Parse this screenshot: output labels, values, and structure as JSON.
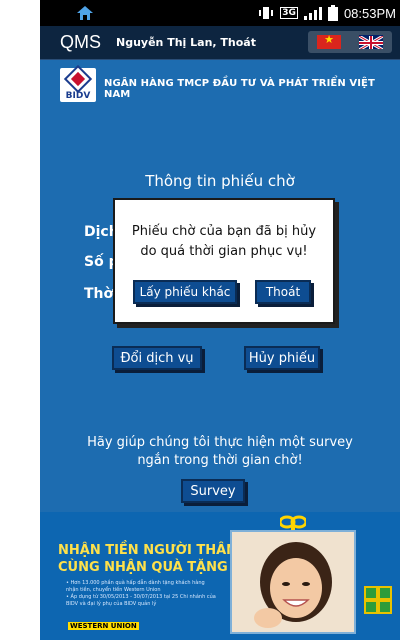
{
  "status": {
    "time": "08:53PM",
    "network": "3G"
  },
  "header": {
    "app_title": "QMS",
    "user_name": "Nguyễn Thị Lan, Thoát"
  },
  "bank": {
    "logo_text": "BIDV",
    "name": "NGÂN HÀNG TMCP ĐẦU TƯ VÀ PHÁT TRIỂN VIỆT NAM"
  },
  "ticket": {
    "title": "Thông tin phiếu chờ",
    "label_service": "Dịch",
    "label_number": "Số p",
    "label_time": "Thờ"
  },
  "actions": {
    "change_service": "Đổi dịch vụ",
    "cancel_ticket": "Hủy phiếu"
  },
  "survey": {
    "line1": "Hãy giúp chúng tôi thực hiện một survey",
    "line2": "ngắn trong thời gian chờ!",
    "button": "Survey"
  },
  "dialog": {
    "line1": "Phiếu chờ của bạn đã bị hủy",
    "line2": "do quá thời gian phục vụ!",
    "primary": "Lấy phiếu khác",
    "secondary": "Thoát"
  },
  "ad": {
    "headline1": "NHẬN TIỀN NGƯỜI THÂN,",
    "headline2": "CÙNG NHẬN QUÀ TẶNG",
    "bullet1": "• Hơn 13.000 phần quà hấp dẫn dành tặng khách hàng nhận tiền, chuyển tiền Western Union",
    "bullet2": "• Áp dụng từ 30/05/2013 - 30/07/2013 tại 25 Chi nhánh của BIDV và đại lý phụ của BIDV quản lý",
    "brand": "WESTERN UNION"
  },
  "colors": {
    "background": "#1d6cb0",
    "button": "#0e4d92",
    "header": "#0d2540",
    "ad_headline": "#ffe14a"
  }
}
